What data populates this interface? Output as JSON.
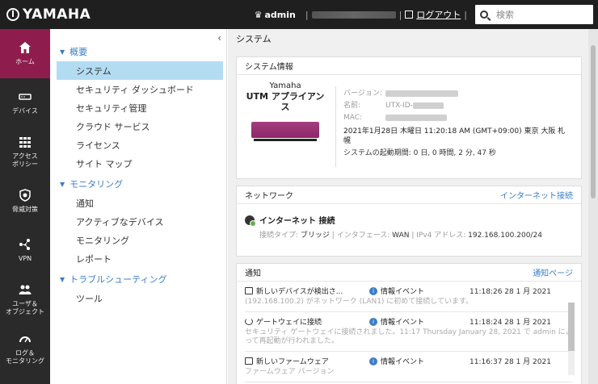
{
  "header": {
    "brand": "YAMAHA",
    "user": "admin",
    "logout_label": "ログアウト",
    "search_placeholder": "検索"
  },
  "rail": [
    {
      "label": "ホーム",
      "icon": "home-icon",
      "active": true
    },
    {
      "label": "デバイス",
      "icon": "device-icon"
    },
    {
      "label": "アクセス\nポリシー",
      "icon": "grid-icon"
    },
    {
      "label": "脅威対策",
      "icon": "shield-icon"
    },
    {
      "label": "VPN",
      "icon": "vpn-icon"
    },
    {
      "label": "ユーザ＆\nオブジェクト",
      "icon": "users-icon"
    },
    {
      "label": "ログ＆\nモニタリング",
      "icon": "gauge-icon"
    }
  ],
  "nav": {
    "sections": [
      {
        "label": "概要",
        "items": [
          "システム",
          "セキュリティ ダッシュボード",
          "セキュリティ管理",
          "クラウド サービス",
          "ライセンス",
          "サイト マップ"
        ]
      },
      {
        "label": "モニタリング",
        "items": [
          "通知",
          "アクティブなデバイス",
          "モニタリング",
          "レポート"
        ]
      },
      {
        "label": "トラブルシューティング",
        "items": [
          "ツール"
        ]
      }
    ]
  },
  "main": {
    "title": "システム",
    "system_info": {
      "heading": "システム情報",
      "product_brand": "Yamaha",
      "product_name": "UTM アプライアンス",
      "version_label": "バージョン:",
      "name_label": "名前:",
      "name_prefix": "UTX-ID-",
      "mac_label": "MAC:",
      "datetime": "2021年1月28日 木曜日 11:20:18 AM (GMT+09:00) 東京 大阪 札幌",
      "uptime": "システムの起動期間: 0 日, 0 時間, 2 分, 47 秒"
    },
    "network": {
      "heading": "ネットワーク",
      "link": "インターネット接続",
      "title": "インターネット 接続",
      "type_label": "接続タイプ:",
      "type_value": "ブリッジ",
      "iface_label": "インタフェース:",
      "iface_value": "WAN",
      "ipv4_label": "IPv4 アドレス:",
      "ipv4_value": "192.168.100.200/24"
    },
    "notifications": {
      "heading": "通知",
      "link": "通知ページ",
      "items": [
        {
          "title": "新しいデバイスが検出さ...",
          "type": "情報イベント",
          "time": "11:18:26 28 1 月 2021",
          "desc": "(192.168.100.2) がネットワーク (LAN1) に初めて接続しています。"
        },
        {
          "title": "ゲートウェイに接続",
          "type": "情報イベント",
          "time": "11:18:24 28 1 月 2021",
          "desc": "セキュリティ ゲートウェイに接続されました。11:17 Thursday January 28, 2021 で admin によって再起動が行われました。"
        },
        {
          "title": "新しいファームウェア",
          "type": "情報イベント",
          "time": "11:16:37 28 1 月 2021",
          "desc": "ファームウェア バージョン"
        }
      ]
    }
  }
}
